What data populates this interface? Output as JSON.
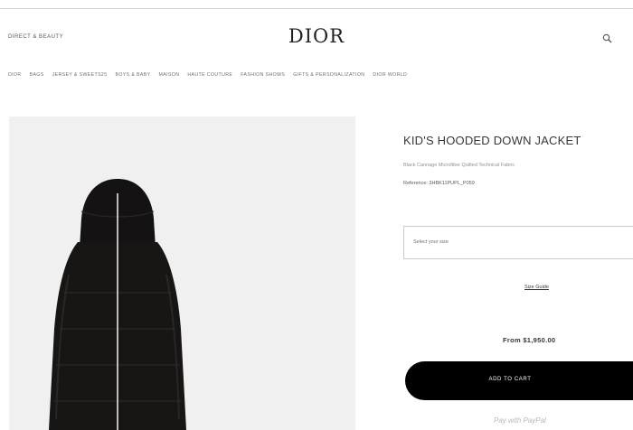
{
  "header": {
    "fashion_link": "DIRECT & BEAUTY",
    "logo": "DIOR",
    "search_icon": "search-icon"
  },
  "nav": {
    "items": [
      "DIOR",
      "BAGS",
      "JERSEY & SWEETS25",
      "BOYS & BABY",
      "MAISON",
      "HAUTE COUTURE",
      "FASHION SHOWS",
      "GIFTS & PERSONALIZATION",
      "DIOR WORLD"
    ]
  },
  "product": {
    "title": "KID'S HOODED DOWN JACKET",
    "subtitle": "Black Cannage Microfiber Quilted Technical Fabric",
    "reference": "Reference: 3HBK11PUPL_P059",
    "size_placeholder": "Select your size",
    "size_guide": "Size Guide",
    "price": "From $1,950.00",
    "add_to_cart": "ADD TO CART",
    "pay_later": "Pay with PayPal"
  },
  "colors": {
    "accent_rule": "#e8c9cf",
    "button_bg": "#000000",
    "image_bg": "#f0f0f0"
  }
}
